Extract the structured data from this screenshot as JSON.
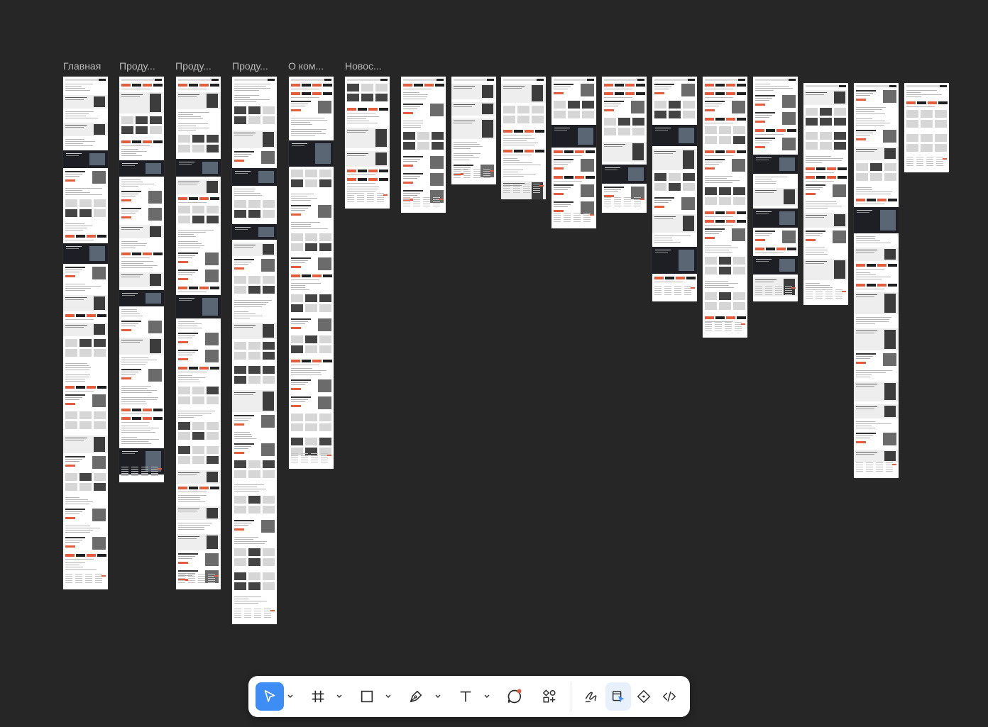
{
  "canvas": {
    "background": "#262626",
    "frame_labels": [
      "Главная",
      "Проду...",
      "Проду...",
      "Проду...",
      "О ком...",
      "Новос..."
    ]
  },
  "colors": {
    "accent": "#e25c3e",
    "dark_section": "#1e1f24",
    "placeholder": "#d6d6d6",
    "toolbar_active": "#3d8df5",
    "toolbar_icon": "#2b2b2b"
  },
  "toolbar": {
    "tools": [
      {
        "name": "move-tool",
        "icon": "cursor-arrow-icon",
        "active": true,
        "has_menu": true
      },
      {
        "name": "frame-tool",
        "icon": "hash-frame-icon",
        "active": false,
        "has_menu": true
      },
      {
        "name": "shape-tool",
        "icon": "rectangle-icon",
        "active": false,
        "has_menu": true
      },
      {
        "name": "pen-tool",
        "icon": "pen-nib-icon",
        "active": false,
        "has_menu": true
      },
      {
        "name": "text-tool",
        "icon": "text-t-icon",
        "active": false,
        "has_menu": true
      },
      {
        "name": "comment-tool",
        "icon": "comment-bubble-icon",
        "active": false,
        "has_menu": false
      },
      {
        "name": "assets-tool",
        "icon": "components-icon",
        "active": false,
        "has_menu": false
      }
    ],
    "modes": [
      {
        "name": "draw-mode",
        "icon": "scribble-icon",
        "active": false
      },
      {
        "name": "design-mode",
        "icon": "design-pointer-icon",
        "active": true
      },
      {
        "name": "prototype-mode",
        "icon": "diamond-node-icon",
        "active": false
      },
      {
        "name": "dev-mode",
        "icon": "code-brackets-icon",
        "active": false
      }
    ]
  }
}
